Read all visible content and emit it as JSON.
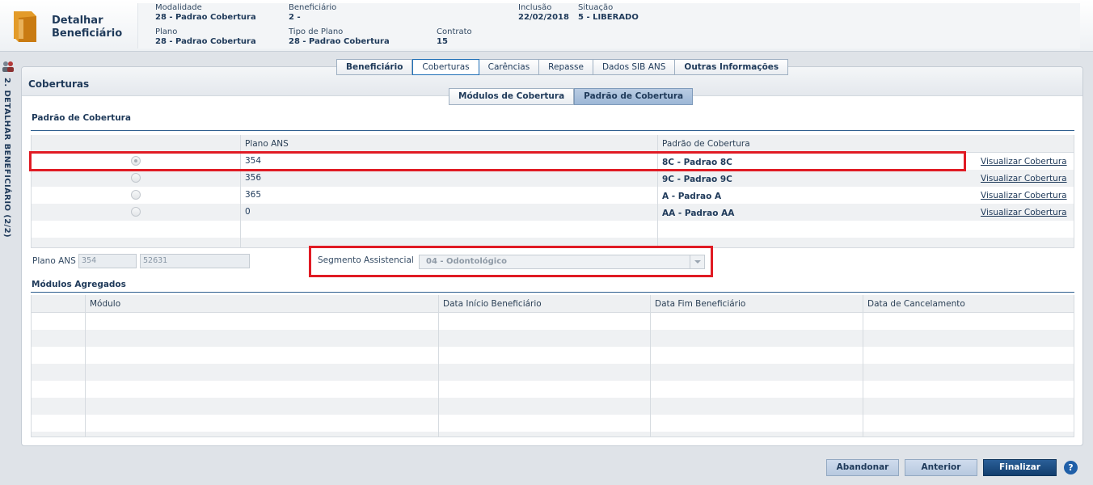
{
  "header": {
    "title_line1": "Detalhar",
    "title_line2": "Beneficiário",
    "fields": {
      "modalidade": {
        "label": "Modalidade",
        "value": "28 - Padrao Cobertura"
      },
      "beneficiario": {
        "label": "Beneficiário",
        "value": "2 -"
      },
      "inclusao": {
        "label": "Inclusão",
        "value": "22/02/2018"
      },
      "situacao": {
        "label": "Situação",
        "value": "5 - LIBERADO"
      },
      "plano": {
        "label": "Plano",
        "value": "28 - Padrao Cobertura"
      },
      "tipo_plano": {
        "label": "Tipo de Plano",
        "value": "28 - Padrao Cobertura"
      },
      "contrato": {
        "label": "Contrato",
        "value": "15"
      }
    }
  },
  "side_tab": {
    "label": "2. DETALHAR BENEFICIÁRIO (2/2)"
  },
  "panel": {
    "title": "Coberturas"
  },
  "tabs": [
    "Beneficiário",
    "Coberturas",
    "Carências",
    "Repasse",
    "Dados SIB ANS",
    "Outras Informações"
  ],
  "active_tab": "Coberturas",
  "subtabs": [
    "Módulos de Cobertura",
    "Padrão de Cobertura"
  ],
  "active_subtab": "Padrão de Cobertura",
  "padrao": {
    "section_title": "Padrão de Cobertura",
    "columns": [
      "",
      "Plano ANS",
      "Padrão de Cobertura",
      ""
    ],
    "rows": [
      {
        "selected": true,
        "plano": "354",
        "padrao": "8C - Padrao 8C",
        "link": "Visualizar Cobertura"
      },
      {
        "selected": false,
        "plano": "356",
        "padrao": "9C - Padrao 9C",
        "link": "Visualizar Cobertura"
      },
      {
        "selected": false,
        "plano": "365",
        "padrao": "A - Padrao A",
        "link": "Visualizar Cobertura"
      },
      {
        "selected": false,
        "plano": "0",
        "padrao": "AA - Padrao AA",
        "link": "Visualizar Cobertura"
      }
    ]
  },
  "plano_ans": {
    "label": "Plano ANS",
    "value1": "354",
    "value2": "52631"
  },
  "segmento": {
    "label": "Segmento Assistencial",
    "value": "04 - Odontológico"
  },
  "modulos": {
    "section_title": "Módulos Agregados",
    "columns": [
      "",
      "Módulo",
      "Data Início Beneficiário",
      "Data Fim Beneficiário",
      "Data de Cancelamento"
    ]
  },
  "footer": {
    "abandonar": "Abandonar",
    "anterior": "Anterior",
    "finalizar": "Finalizar",
    "help": "?"
  },
  "colors": {
    "highlight": "#e01b24",
    "primary": "#123e6e",
    "text": "#1f3a5a"
  }
}
